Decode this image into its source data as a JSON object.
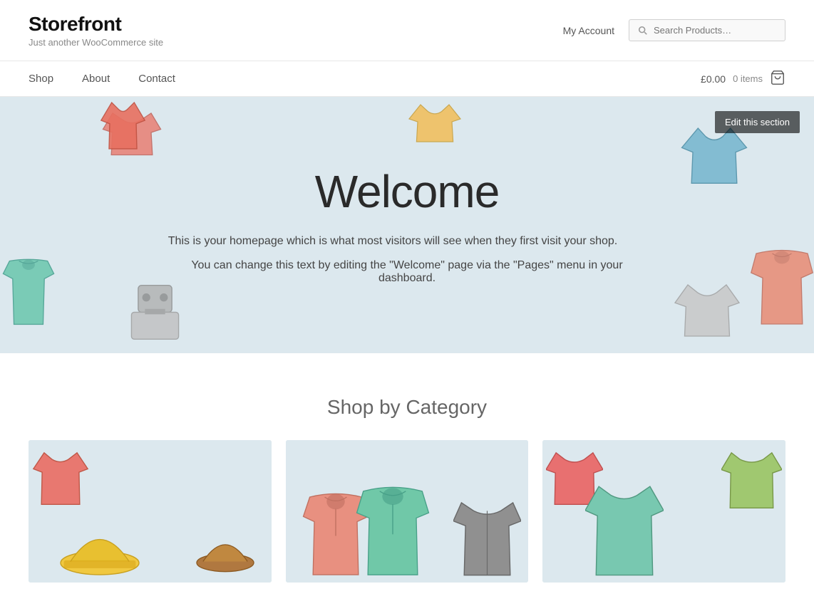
{
  "header": {
    "logo": {
      "title": "Storefront",
      "subtitle": "Just another WooCommerce site"
    },
    "my_account": "My Account",
    "search": {
      "placeholder": "Search Products…"
    }
  },
  "nav": {
    "links": [
      {
        "label": "Shop",
        "name": "shop"
      },
      {
        "label": "About",
        "name": "about"
      },
      {
        "label": "Contact",
        "name": "contact"
      }
    ],
    "cart": {
      "amount": "£0.00",
      "items": "0 items"
    }
  },
  "hero": {
    "edit_label": "Edit this section",
    "title": "Welcome",
    "text1": "This is your homepage which is what most visitors will see when they first visit your shop.",
    "text2": "You can change this text by editing the \"Welcome\" page via the \"Pages\" menu in your dashboard."
  },
  "shop_section": {
    "title": "Shop by Category"
  },
  "colors": {
    "hero_bg": "#dce8ee",
    "logo_color": "#111",
    "nav_link": "#555"
  }
}
